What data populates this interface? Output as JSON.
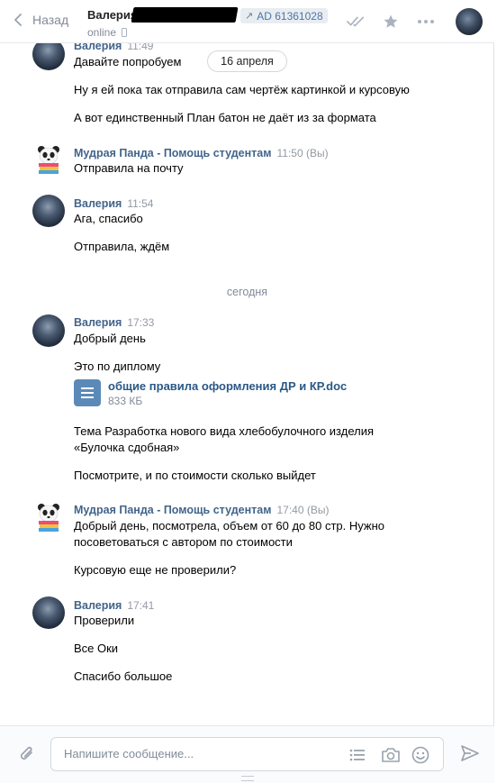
{
  "header": {
    "back_label": "Назад",
    "contact_name": "Валерия",
    "ad_label": "AD 61361028",
    "status": "online"
  },
  "date_pill": "16 апреля",
  "day_separator": "сегодня",
  "messages": [
    {
      "author": "Валерия",
      "time": "11:49",
      "lines": [
        "Давайте попробуем",
        "Ну я ей пока так отправила сам чертёж картинкой и курсовую",
        "А вот единственный План батон не даёт из за формата"
      ]
    },
    {
      "author": "Мудрая Панда - Помощь студентам",
      "time": "11:50 (Вы)",
      "lines": [
        "Отправила на почту"
      ]
    },
    {
      "author": "Валерия",
      "time": "11:54",
      "lines": [
        "Ага, спасибо",
        "Отправила, ждём"
      ]
    },
    {
      "author": "Валерия",
      "time": "17:33",
      "lines": [
        "Добрый день",
        "Это по диплому",
        "Тема Разработка нового вида хлебобулочного изделия",
        "«Булочка сдобная»",
        "Посмотрите, и по стоимости сколько выйдет"
      ],
      "document": {
        "name": "общие правила оформления ДР и КР.doc",
        "size": "833 КБ"
      }
    },
    {
      "author": "Мудрая Панда - Помощь студентам",
      "time": "17:40 (Вы)",
      "lines": [
        "Добрый день, посмотрела, объем от 60 до 80 стр. Нужно",
        "посоветоваться с автором по стоимости",
        "Курсовую еще не проверили?"
      ]
    },
    {
      "author": "Валерия",
      "time": "17:41",
      "lines": [
        "Проверили",
        "Все Оки",
        "Спасибо большое"
      ]
    }
  ],
  "composer": {
    "placeholder": "Напишите сообщение..."
  },
  "colors": {
    "link": "#42648b",
    "accent": "#5181b8",
    "muted": "#828a99"
  }
}
